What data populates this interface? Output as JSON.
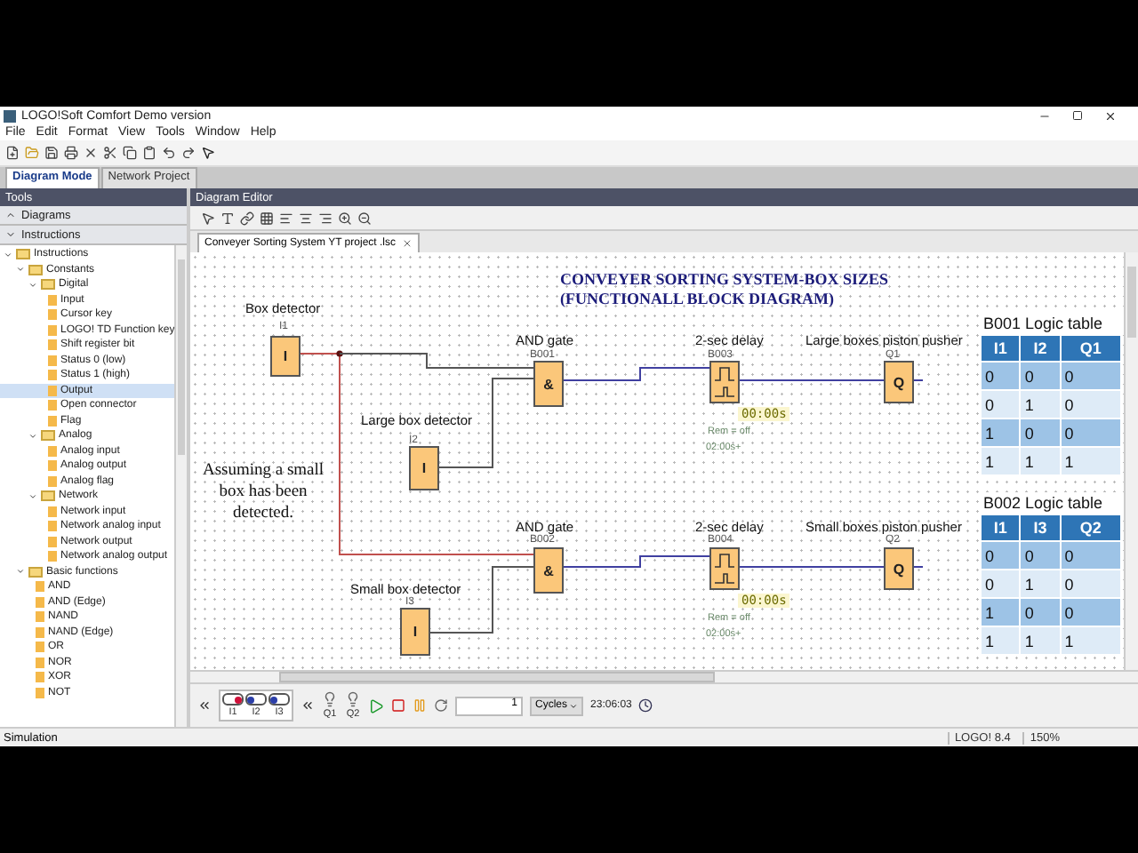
{
  "window": {
    "title": "LOGO!Soft Comfort Demo version"
  },
  "menu": [
    "File",
    "Edit",
    "Format",
    "View",
    "Tools",
    "Window",
    "Help"
  ],
  "tabs": [
    {
      "label": "Diagram Mode",
      "selected": true
    },
    {
      "label": "Network Project",
      "selected": false
    }
  ],
  "tools_panel": {
    "title": "Tools",
    "sections": [
      {
        "label": "Diagrams",
        "expanded": false
      },
      {
        "label": "Instructions",
        "expanded": true
      }
    ],
    "tree": [
      {
        "label": "Instructions",
        "expanded": true,
        "selected": false,
        "children": [
          {
            "label": "Constants",
            "expanded": true,
            "selected": false,
            "children": [
              {
                "label": "Digital",
                "expanded": true,
                "selected": false,
                "children": [
                  {
                    "label": "Input",
                    "selected": false
                  },
                  {
                    "label": "Cursor key",
                    "selected": false
                  },
                  {
                    "label": "LOGO! TD Function key",
                    "selected": false
                  },
                  {
                    "label": "Shift register bit",
                    "selected": false
                  },
                  {
                    "label": "Status 0 (low)",
                    "selected": false
                  },
                  {
                    "label": "Status 1 (high)",
                    "selected": false
                  },
                  {
                    "label": "Output",
                    "selected": true
                  },
                  {
                    "label": "Open connector",
                    "selected": false
                  },
                  {
                    "label": "Flag",
                    "selected": false
                  }
                ]
              },
              {
                "label": "Analog",
                "expanded": true,
                "selected": false,
                "children": [
                  {
                    "label": "Analog input",
                    "selected": false
                  },
                  {
                    "label": "Analog output",
                    "selected": false
                  },
                  {
                    "label": "Analog flag",
                    "selected": false
                  }
                ]
              },
              {
                "label": "Network",
                "expanded": true,
                "selected": false,
                "children": [
                  {
                    "label": "Network input",
                    "selected": false
                  },
                  {
                    "label": "Network analog input",
                    "selected": false
                  },
                  {
                    "label": "Network output",
                    "selected": false
                  },
                  {
                    "label": "Network analog output",
                    "selected": false
                  }
                ]
              }
            ]
          },
          {
            "label": "Basic functions",
            "expanded": true,
            "selected": false,
            "children": [
              {
                "label": "AND",
                "selected": false
              },
              {
                "label": "AND (Edge)",
                "selected": false
              },
              {
                "label": "NAND",
                "selected": false
              },
              {
                "label": "NAND (Edge)",
                "selected": false
              },
              {
                "label": "OR",
                "selected": false
              },
              {
                "label": "NOR",
                "selected": false
              },
              {
                "label": "XOR",
                "selected": false
              },
              {
                "label": "NOT",
                "selected": false
              }
            ]
          }
        ]
      }
    ]
  },
  "editor": {
    "title": "Diagram Editor",
    "document_tab": "Conveyer Sorting System YT project .lsc",
    "diagram": {
      "title_lines": [
        "CONVEYER SORTING SYSTEM-BOX SIZES",
        "(FUNCTIONALL BLOCK DIAGRAM)"
      ],
      "annotation": "Assuming a small box has been detected.",
      "blocks": [
        {
          "kind": "input",
          "caption": "Box detector",
          "id_label": "I1",
          "symbol": "I"
        },
        {
          "kind": "input",
          "caption": "Large box detector",
          "id_label": "I2",
          "symbol": "I"
        },
        {
          "kind": "input",
          "caption": "Small box detector",
          "id_label": "I3",
          "symbol": "I"
        },
        {
          "kind": "and",
          "caption": "AND gate",
          "id_label": "B001",
          "symbol": "&"
        },
        {
          "kind": "and",
          "caption": "AND gate",
          "id_label": "B002",
          "symbol": "&"
        },
        {
          "kind": "timer",
          "caption": "2-sec delay",
          "id_label": "B003",
          "time": "00:00s",
          "rem": "Rem = off",
          "preset": "02:00s+"
        },
        {
          "kind": "timer",
          "caption": "2-sec delay",
          "id_label": "B004",
          "time": "00:00s",
          "rem": "Rem = off",
          "preset": "02:00s+"
        },
        {
          "kind": "output",
          "caption": "Large boxes piston pusher",
          "id_label": "Q1",
          "symbol": "Q"
        },
        {
          "kind": "output",
          "caption": "Small boxes piston pusher",
          "id_label": "Q2",
          "symbol": "Q"
        }
      ]
    },
    "logic_tables": [
      {
        "title": "B001 Logic table",
        "columns": [
          "I1",
          "I2",
          "Q1"
        ],
        "rows": [
          [
            "0",
            "0",
            "0"
          ],
          [
            "0",
            "1",
            "0"
          ],
          [
            "1",
            "0",
            "0"
          ],
          [
            "1",
            "1",
            "1"
          ]
        ]
      },
      {
        "title": "B002 Logic table",
        "columns": [
          "I1",
          "I3",
          "Q2"
        ],
        "rows": [
          [
            "0",
            "0",
            "0"
          ],
          [
            "0",
            "1",
            "0"
          ],
          [
            "1",
            "0",
            "0"
          ],
          [
            "1",
            "1",
            "1"
          ]
        ]
      }
    ]
  },
  "simulation": {
    "inputs": [
      {
        "label": "I1",
        "on": true
      },
      {
        "label": "I2",
        "on": false
      },
      {
        "label": "I3",
        "on": false
      }
    ],
    "outputs": [
      {
        "label": "Q1"
      },
      {
        "label": "Q2"
      }
    ],
    "cycles_value": "1",
    "cycles_unit": "Cycles",
    "time": "23:06:03"
  },
  "status_bar": {
    "mode": "Simulation",
    "device": "LOGO! 8.4",
    "zoom": "150%"
  }
}
